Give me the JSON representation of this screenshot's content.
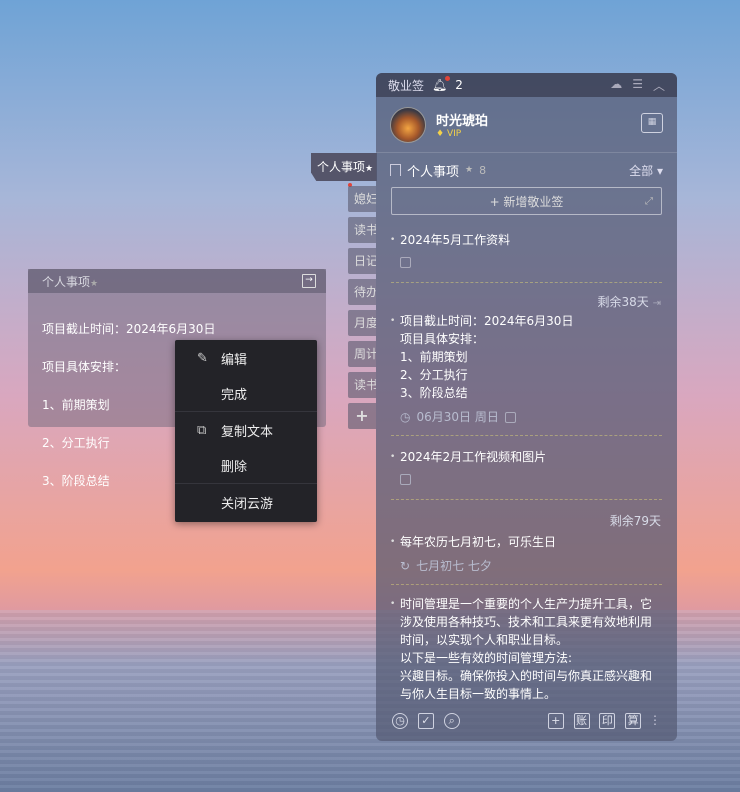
{
  "note": {
    "title": "个人事项",
    "star": "★",
    "lines": [
      "项目截止时间：2024年6月30日",
      "项目具体安排：",
      "1、前期策划",
      "2、分工执行",
      "3、阶段总结"
    ]
  },
  "side_tabs": {
    "active": "个人事项",
    "items": [
      "媳妇",
      "读书",
      "日记",
      "待办",
      "月度",
      "周计",
      "读书"
    ],
    "add": "+"
  },
  "context_menu": {
    "items": [
      "编辑",
      "完成",
      "复制文本",
      "删除",
      "关闭云游"
    ]
  },
  "panel": {
    "app_title": "敬业签",
    "notif_count": "2",
    "user_name": "时光琥珀",
    "vip": "VIP",
    "category": "个人事项",
    "category_count": "8",
    "filter": "全部",
    "add_button": "+ 新增敬业签",
    "notes": [
      {
        "text": "2024年5月工作资料"
      },
      {
        "remain": "剩余38天",
        "lines": [
          "项目截止时间：2024年6月30日",
          "项目具体安排：",
          "1、前期策划",
          "2、分工执行",
          "3、阶段总结"
        ],
        "date": "06月30日 周日"
      },
      {
        "text": "2024年2月工作视频和图片"
      },
      {
        "remain": "剩余79天",
        "lines": [
          "每年农历七月初七，可乐生日"
        ],
        "repeat": "七月初七 七夕"
      },
      {
        "lines": [
          "时间管理是一个重要的个人生产力提升工具，它",
          "涉及使用各种技巧、技术和工具来更有效地利用",
          "时间，以实现个人和职业目标。",
          "以下是一些有效的时间管理方法:",
          "兴趣目标。确保你投入的时间与你真正感兴趣和",
          "与你人生目标一致的事情上。"
        ]
      }
    ],
    "bottom_tools": [
      "账",
      "印",
      "算"
    ]
  }
}
